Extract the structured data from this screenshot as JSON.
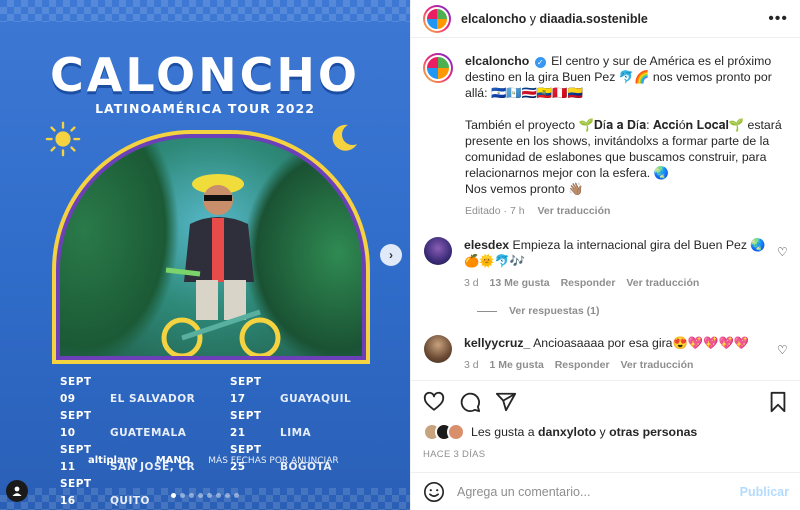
{
  "colors": {
    "accent": "#0095f6",
    "muted": "#8e8e8e",
    "poster_blue": "#2f6cc9",
    "frame_yellow": "#f4d240",
    "frame_purple": "#6b40b8"
  },
  "poster": {
    "title": "CALONCHO",
    "subtitle": "LATINOAMÉRICA TOUR 2022",
    "dates_left": [
      {
        "date": "SEPT 09",
        "city": "EL SALVADOR"
      },
      {
        "date": "SEPT 10",
        "city": "GUATEMALA"
      },
      {
        "date": "SEPT 11",
        "city": "SAN JOSÉ, CR"
      },
      {
        "date": "SEPT 16",
        "city": "QUITO"
      }
    ],
    "dates_right": [
      {
        "date": "SEPT 17",
        "city": "GUAYAQUIL"
      },
      {
        "date": "SEPT 21",
        "city": "LIMA"
      },
      {
        "date": "SEPT 25",
        "city": "BOGOTÁ"
      }
    ],
    "sponsor1": "altiplano",
    "sponsor2": "MANO",
    "more_dates": "MÁS FECHAS POR ANUNCIAR",
    "carousel": {
      "slides": 8,
      "active": 1
    }
  },
  "header": {
    "user1": "elcaloncho",
    "joiner": "y",
    "user2": "diaadia.sostenible",
    "more_icon": "more-horizontal-icon"
  },
  "caption": {
    "username": "elcaloncho",
    "text1": "El centro y sur de América es el próximo destino en la gira Buen Pez 🐬🌈 nos vemos pronto por allá: 🇸🇻🇬🇹🇨🇷🇪🇨🇵🇪🇨🇴",
    "text2": "También el proyecto 🌱𝐃í𝐚 𝐚 𝐃í𝐚: 𝐀𝐜𝐜𝐢ó𝐧 𝐋𝐨𝐜𝐚𝐥🌱 estará presente en los shows, invitándolxs a formar parte de la comunidad de eslabones que buscamos construir, para relacionarnos mejor con la esfera. 🌏",
    "text3": "Nos vemos pronto 👋🏽",
    "edited": "Editado · 7 h",
    "translate": "Ver traducción"
  },
  "comments": [
    {
      "username": "elesdex",
      "text": "Empieza la internacional gira del Buen Pez 🌏🍊🌞🐬🎶",
      "age": "3 d",
      "likes": "13 Me gusta",
      "reply": "Responder",
      "translate": "Ver traducción",
      "view_replies": "Ver respuestas (1)"
    },
    {
      "username": "kellyycruz_",
      "text": "Ancioasaaaa por esa gira😍💖💖💖💖",
      "age": "3 d",
      "likes": "1 Me gusta",
      "reply": "Responder",
      "translate": "Ver traducción"
    }
  ],
  "likes": {
    "prefix": "Les gusta a",
    "user": "danxyloto",
    "joiner": "y",
    "others": "otras personas"
  },
  "time_ago": "HACE 3 DÍAS",
  "composer": {
    "placeholder": "Agrega un comentario...",
    "post": "Publicar"
  }
}
